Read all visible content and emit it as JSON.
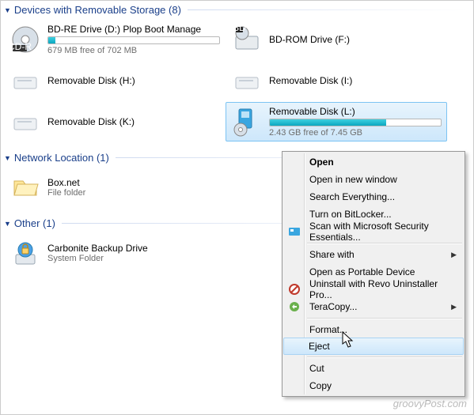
{
  "groups": {
    "removable": {
      "title": "Devices with Removable Storage (8)"
    },
    "network": {
      "title": "Network Location (1)"
    },
    "other": {
      "title": "Other (1)"
    }
  },
  "drives": {
    "bdre": {
      "name": "BD-RE Drive (D:) Plop Boot Manage",
      "sub": "679 MB free of 702 MB",
      "pct": 4
    },
    "bdrom": {
      "name": "BD-ROM Drive (F:)"
    },
    "rh": {
      "name": "Removable Disk (H:)"
    },
    "ri": {
      "name": "Removable Disk (I:)"
    },
    "rk": {
      "name": "Removable Disk (K:)"
    },
    "rl": {
      "name": "Removable Disk (L:)",
      "sub": "2.43 GB free of 7.45 GB",
      "pct": 68
    },
    "box": {
      "name": "Box.net",
      "sub": "File folder"
    },
    "carbonite": {
      "name": "Carbonite Backup Drive",
      "sub": "System Folder"
    }
  },
  "menu": {
    "open": "Open",
    "openwin": "Open in new window",
    "search": "Search Everything...",
    "bitlocker": "Turn on BitLocker...",
    "msse": "Scan with Microsoft Security Essentials...",
    "share": "Share with",
    "portable": "Open as Portable Device",
    "revo": "Uninstall with Revo Uninstaller Pro...",
    "tera": "TeraCopy...",
    "format": "Format...",
    "eject": "Eject",
    "cut": "Cut",
    "copy": "Copy"
  },
  "watermark": "groovyPost.com"
}
